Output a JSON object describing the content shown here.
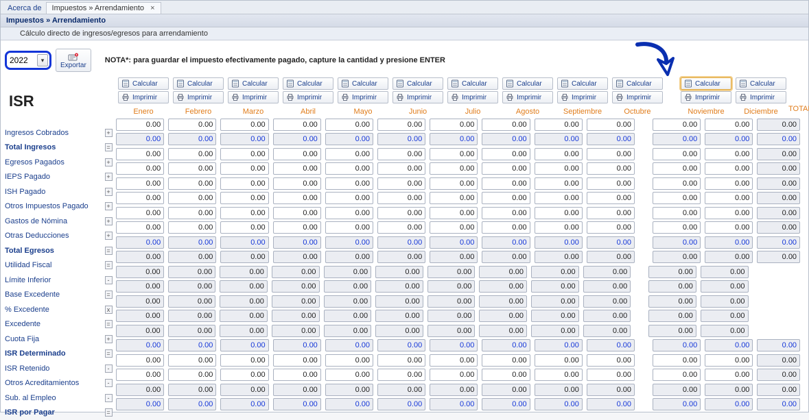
{
  "tabs": {
    "acerca": "Acerca de",
    "main": "Impuestos » Arrendamiento",
    "close": "×"
  },
  "breadcrumb": "Impuestos » Arrendamiento",
  "subtitle": "Cálculo directo de ingresos/egresos para arrendamiento",
  "year": "2022",
  "exportLabel": "Exportar",
  "nota": "NOTA*: para guardar el impuesto efectivamente pagado, capture la cantidad y presione ENTER",
  "sectionTitle": "ISR",
  "calcLabel": "Calcular",
  "printLabel": "Imprimir",
  "highlightMonthIndex": 10,
  "months": [
    "Enero",
    "Febrero",
    "Marzo",
    "Abril",
    "Mayo",
    "Junio",
    "Julio",
    "Agosto",
    "Septiembre",
    "Octubre",
    "Noviembre",
    "Diciembre"
  ],
  "totalLabel": "TOTAL",
  "rows": [
    {
      "label": "Ingresos Cobrados",
      "sym": "+",
      "bold": false,
      "editable": true,
      "blue": false,
      "hasTotal": true,
      "totalRO": true
    },
    {
      "label": "Total Ingresos",
      "sym": "=",
      "bold": true,
      "editable": false,
      "blue": true,
      "hasTotal": true,
      "totalRO": true
    },
    {
      "label": "Egresos Pagados",
      "sym": "+",
      "bold": false,
      "editable": true,
      "blue": false,
      "hasTotal": true,
      "totalRO": true
    },
    {
      "label": "IEPS Pagado",
      "sym": "+",
      "bold": false,
      "editable": true,
      "blue": false,
      "hasTotal": true,
      "totalRO": true
    },
    {
      "label": "ISH Pagado",
      "sym": "+",
      "bold": false,
      "editable": true,
      "blue": false,
      "hasTotal": true,
      "totalRO": true
    },
    {
      "label": "Otros Impuestos Pagado",
      "sym": "+",
      "bold": false,
      "editable": true,
      "blue": false,
      "hasTotal": true,
      "totalRO": true
    },
    {
      "label": "Gastos de Nómina",
      "sym": "+",
      "bold": false,
      "editable": true,
      "blue": false,
      "hasTotal": true,
      "totalRO": true
    },
    {
      "label": "Otras Deducciones",
      "sym": "+",
      "bold": false,
      "editable": true,
      "blue": false,
      "hasTotal": true,
      "totalRO": true
    },
    {
      "label": "Total Egresos",
      "sym": "=",
      "bold": true,
      "editable": false,
      "blue": true,
      "hasTotal": true,
      "totalRO": true
    },
    {
      "label": "Utilidad Fiscal",
      "sym": "=",
      "bold": false,
      "editable": false,
      "blue": false,
      "hasTotal": true,
      "totalRO": true
    },
    {
      "label": "Límite Inferior",
      "sym": "-",
      "bold": false,
      "editable": false,
      "blue": false,
      "hasTotal": false
    },
    {
      "label": "Base Excedente",
      "sym": "=",
      "bold": false,
      "editable": false,
      "blue": false,
      "hasTotal": false
    },
    {
      "label": "% Excedente",
      "sym": "x",
      "bold": false,
      "editable": false,
      "blue": false,
      "hasTotal": false
    },
    {
      "label": "Excedente",
      "sym": "=",
      "bold": false,
      "editable": false,
      "blue": false,
      "hasTotal": false
    },
    {
      "label": "Cuota Fija",
      "sym": "+",
      "bold": false,
      "editable": false,
      "blue": false,
      "hasTotal": false
    },
    {
      "label": "ISR Determinado",
      "sym": "=",
      "bold": true,
      "editable": false,
      "blue": true,
      "hasTotal": true,
      "totalRO": true
    },
    {
      "label": "ISR Retenido",
      "sym": "-",
      "bold": false,
      "editable": true,
      "blue": false,
      "hasTotal": true,
      "totalRO": true
    },
    {
      "label": "Otros Acreditamientos",
      "sym": "-",
      "bold": false,
      "editable": true,
      "blue": false,
      "hasTotal": true,
      "totalRO": true
    },
    {
      "label": "Sub. al Empleo",
      "sym": "-",
      "bold": false,
      "editable": false,
      "blue": false,
      "hasTotal": true,
      "totalRO": true
    },
    {
      "label": "ISR por Pagar",
      "sym": "=",
      "bold": true,
      "editable": false,
      "blue": true,
      "hasTotal": true,
      "totalRO": true
    }
  ],
  "cellValue": "0.00",
  "gapAfterMonthIndex": 9
}
